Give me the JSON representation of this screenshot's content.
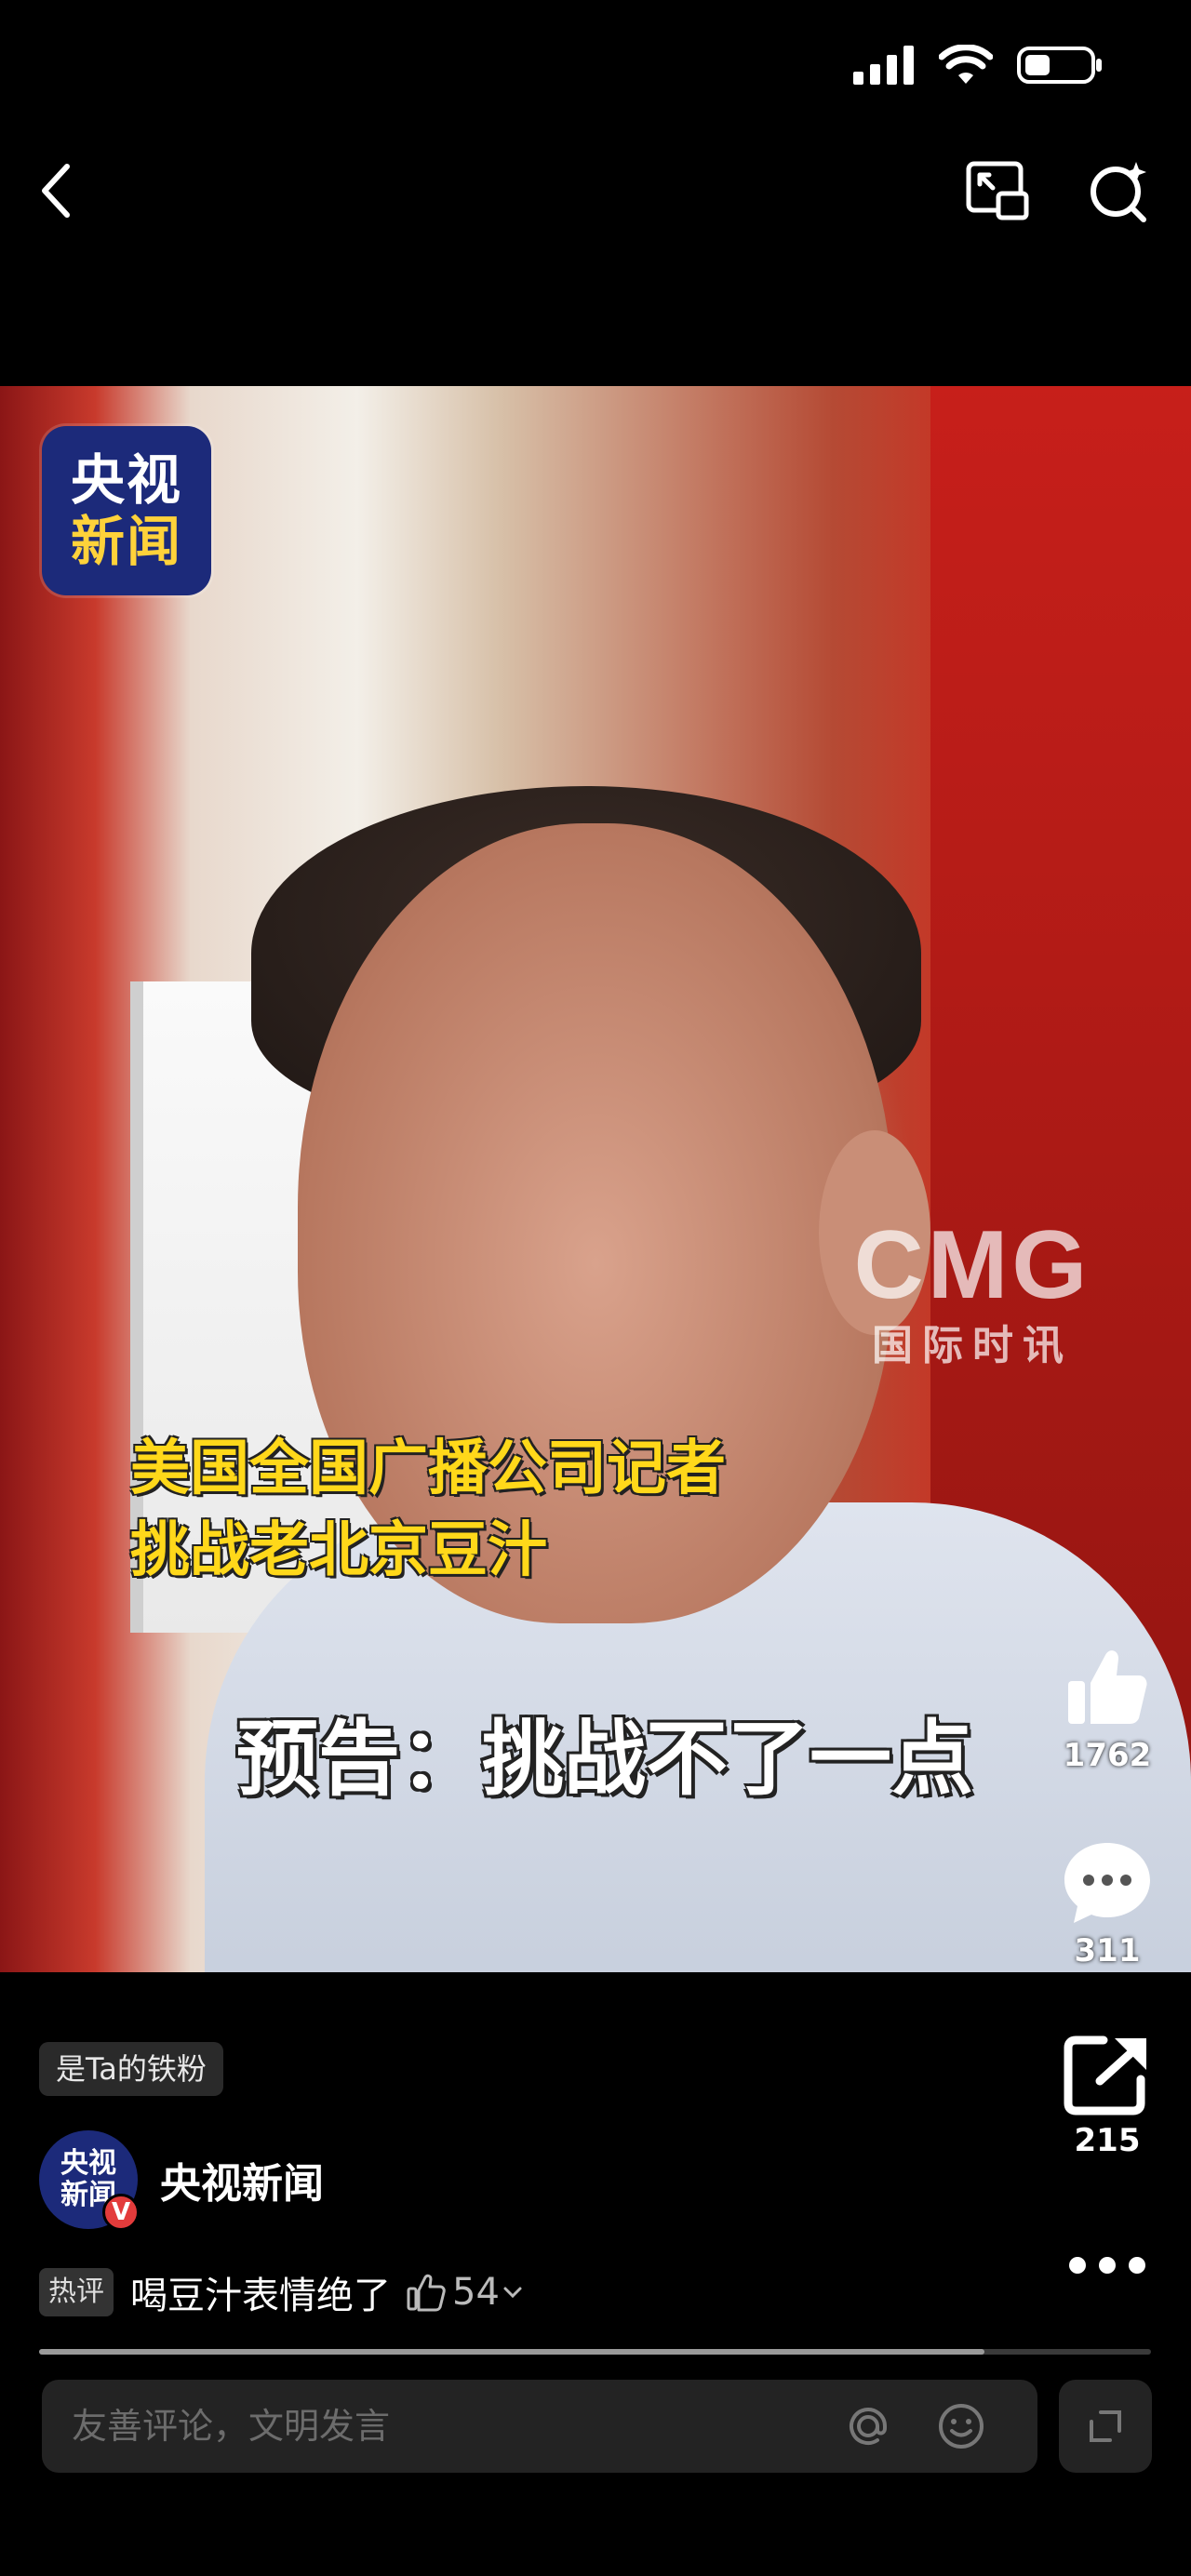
{
  "video": {
    "logo_line1": "央视",
    "logo_line2": "新闻",
    "watermark_main": "CMG",
    "watermark_sub": "国际时讯",
    "caption_line1": "美国全国广播公司记者",
    "caption_line2": "挑战老北京豆汁",
    "subtitle": "预告：挑战不了一点",
    "progress": 0.85
  },
  "actions": {
    "like_count": "1762",
    "comment_count": "311",
    "share_count": "215"
  },
  "fan_badge": "是Ta的铁粉",
  "author": {
    "avatar_line1": "央视",
    "avatar_line2": "新闻",
    "verified": "V",
    "name": "央视新闻"
  },
  "hot_comment": {
    "tag": "热评",
    "text": "喝豆汁表情绝了",
    "likes": "54"
  },
  "comment_input": {
    "placeholder": "友善评论，文明发言"
  },
  "icons": {
    "back": "chevron-left-icon",
    "pip": "picture-in-picture-icon",
    "search": "search-icon",
    "like": "thumbs-up-icon",
    "comment": "comment-bubble-icon",
    "share": "share-icon",
    "more": "more-dots-icon",
    "at": "at-icon",
    "emoji": "emoji-icon",
    "expand": "expand-icon"
  }
}
